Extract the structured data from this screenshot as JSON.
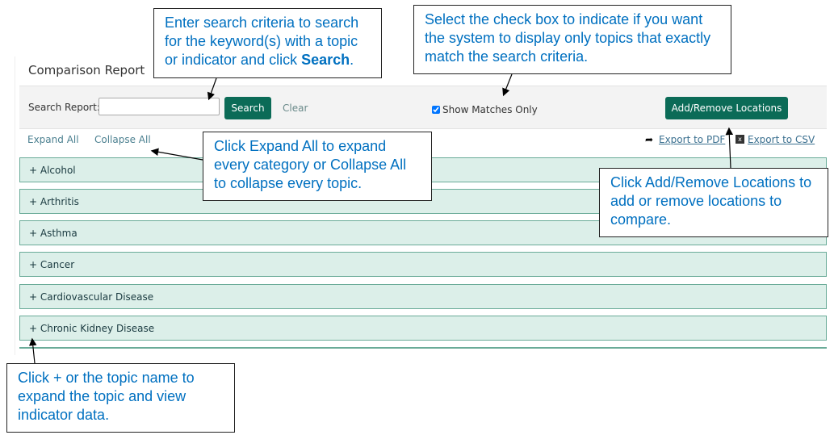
{
  "page": {
    "title": "Comparison Report"
  },
  "toolbar": {
    "search_label": "Search Report:",
    "search_value": "",
    "search_button": "Search",
    "clear": "Clear",
    "show_matches": "Show Matches Only",
    "show_matches_checked": true,
    "add_remove": "Add/Remove Locations"
  },
  "actions": {
    "expand_all": "Expand All",
    "collapse_all": "Collapse All",
    "export_pdf": "Export to PDF",
    "export_csv": "Export to CSV",
    "export_pdf_icon": "share-arrow-icon",
    "export_csv_icon": "excel-icon"
  },
  "topics": [
    "+ Alcohol",
    "+ Arthritis",
    "+ Asthma",
    "+ Cancer",
    "+ Cardiovascular Disease",
    "+ Chronic Kidney Disease"
  ],
  "callouts": {
    "search": {
      "text": "Enter search criteria to search for the keyword(s) with a topic or indicator and click ",
      "bold": "Search",
      "end": "."
    },
    "matches": "Select the check box to indicate if you want the system to display only topics that exactly match the search criteria.",
    "expand": "Click Expand All to expand every category or Collapse All to collapse every topic.",
    "locations": "Click Add/Remove Locations to add or remove locations to compare.",
    "topic": "Click + or the topic name to expand the topic and view indicator data."
  },
  "colors": {
    "accent": "#0b6b57",
    "callout_text": "#0070c0",
    "row_bg": "#dcefe9"
  }
}
